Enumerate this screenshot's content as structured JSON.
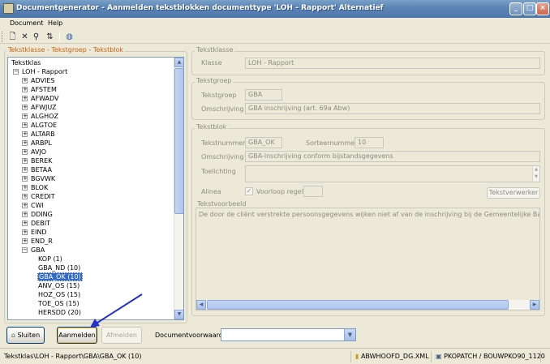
{
  "window": {
    "title": "Documentgenerator - Aanmelden tekstblokken documenttype 'LOH - Rapport' Alternatief",
    "minimize": "_",
    "maximize": "□",
    "close": "×"
  },
  "menu": [
    "Document",
    "Help"
  ],
  "toolbar": {
    "icons": [
      "new-document-icon",
      "delete-icon",
      "find-icon",
      "sort-icon",
      "globe-icon"
    ]
  },
  "tree_panel": {
    "title": "Tekstklasse - Tekstgroep - Tekstblok",
    "root": "Tekstklas",
    "klasse": "LOH - Rapport",
    "groups": [
      "ADVIES",
      "AFSTEM",
      "AFWADV",
      "AFWJUZ",
      "ALGHOZ",
      "ALGTOE",
      "ALTARB",
      "ARBPL",
      "AVJO",
      "BEREK",
      "BETAA",
      "BGVWK",
      "BLOK",
      "CREDIT",
      "CWI",
      "DDING",
      "DEBIT",
      "EIND",
      "END_R",
      "GBA"
    ],
    "gba_children": [
      "KOP (1)",
      "GBA_ND (10)",
      "GBA_OK (10)",
      "ANV_OS (15)",
      "HOZ_OS (15)",
      "TOE_OS (15)",
      "HERSDD (20)"
    ],
    "selected": "GBA_OK (10)"
  },
  "tekstklasse": {
    "title": "Tekstklasse",
    "klasse_label": "Klasse",
    "klasse_value": "LOH - Rapport"
  },
  "tekstgroep": {
    "title": "Tekstgroep",
    "groep_label": "Tekstgroep",
    "groep_value": "GBA",
    "omschrijving_label": "Omschrijving",
    "omschrijving_value": "GBA inschrijving (art. 69a Abw)"
  },
  "tekstblok": {
    "title": "Tekstblok",
    "nummer_label": "Tekstnummer",
    "nummer_value": "GBA_OK",
    "sorteer_label": "Sorteernummer",
    "sorteer_value": "10",
    "omschrijving_label": "Omschrijving",
    "omschrijving_value": "GBA-inschrijving conform bijstandsgegevens",
    "toelichting_label": "Toelichting",
    "alinea_label": "Alinea",
    "voorloop_label": "Voorloop regels",
    "verwerker_button": "Tekstverwerker",
    "voorbeeld_title": "Tekstvoorbeeld",
    "voorbeeld_text": "De door de cliënt verstrekte persoonsgegevens wijken niet af van de inschrijving bij de Gemeentelijke Basisadmin"
  },
  "buttons": {
    "sluiten": "Sluiten",
    "aanmelden": "Aanmelden",
    "afmelden": "Afmelden",
    "documentvoorwaarde_label": "Documentvoorwaarde"
  },
  "statusbar": {
    "path": "Tekstklas\\LOH - Rapport\\GBA\\GBA_OK (10)",
    "file": "ABWHOOFD_DG.XML",
    "server": "PKOPATCH / BOUWPKO90_1120"
  },
  "colors": {
    "titlebar": "#5E86B6",
    "selection": "#316AC5",
    "group_title": "#C86410",
    "annotation_arrow": "#2430C8"
  }
}
